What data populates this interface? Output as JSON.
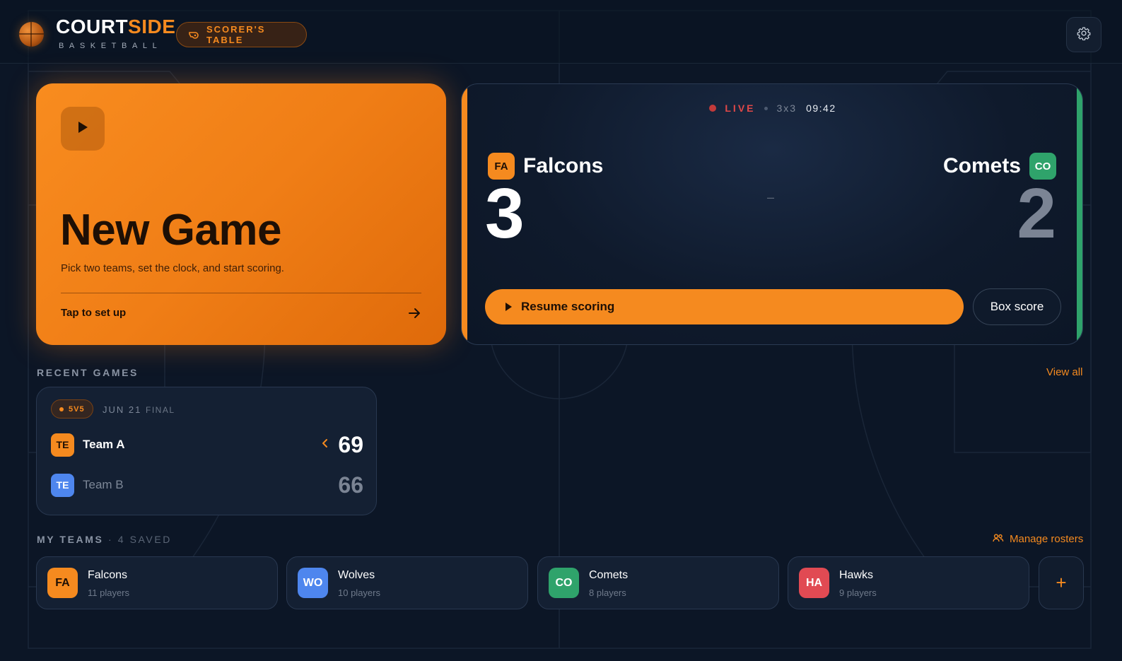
{
  "brand": {
    "name_part1": "COURT",
    "name_part2": "SIDE",
    "subtitle": "BASKETBALL"
  },
  "header": {
    "mode_pill": "SCORER'S TABLE",
    "mode_icon": "whistle-icon",
    "settings_icon": "gear-icon"
  },
  "new_game": {
    "icon": "play-icon",
    "title": "New Game",
    "subtitle": "Pick two teams, set the clock, and start scoring.",
    "cta": "Tap to set up",
    "cta_icon": "arrow-right-icon"
  },
  "live_game": {
    "status": "LIVE",
    "format": "3x3",
    "clock": "09:42",
    "home": {
      "abbr": "FA",
      "name": "Falcons",
      "score": "3",
      "color": "#f58a1f"
    },
    "away": {
      "abbr": "CO",
      "name": "Comets",
      "score": "2",
      "color": "#2fa36b"
    },
    "separator": "–",
    "resume_label": "Resume scoring",
    "box_score_label": "Box score"
  },
  "recent": {
    "title": "RECENT GAMES",
    "view_all": "View all",
    "games": [
      {
        "format": "5V5",
        "date": "JUN 21",
        "status": "FINAL",
        "teams": [
          {
            "abbr": "TE",
            "name": "Team A",
            "score": "69",
            "color": "#f58a1f",
            "winner": true
          },
          {
            "abbr": "TE",
            "name": "Team B",
            "score": "66",
            "color": "#4e86ee",
            "winner": false
          }
        ]
      }
    ]
  },
  "my_teams": {
    "title": "MY TEAMS",
    "count_label": "· 4 SAVED",
    "manage_label": "Manage rosters",
    "manage_icon": "users-icon",
    "add_label": "+",
    "teams": [
      {
        "abbr": "FA",
        "name": "Falcons",
        "players": "11 players",
        "color": "#f58a1f"
      },
      {
        "abbr": "WO",
        "name": "Wolves",
        "players": "10 players",
        "color": "#4e86ee"
      },
      {
        "abbr": "CO",
        "name": "Comets",
        "players": "8 players",
        "color": "#2fa36b"
      },
      {
        "abbr": "HA",
        "name": "Hawks",
        "players": "9 players",
        "color": "#e14a53"
      }
    ]
  },
  "colors": {
    "accent": "#f58a1f",
    "background": "#0c1626",
    "live": "#e04848"
  }
}
